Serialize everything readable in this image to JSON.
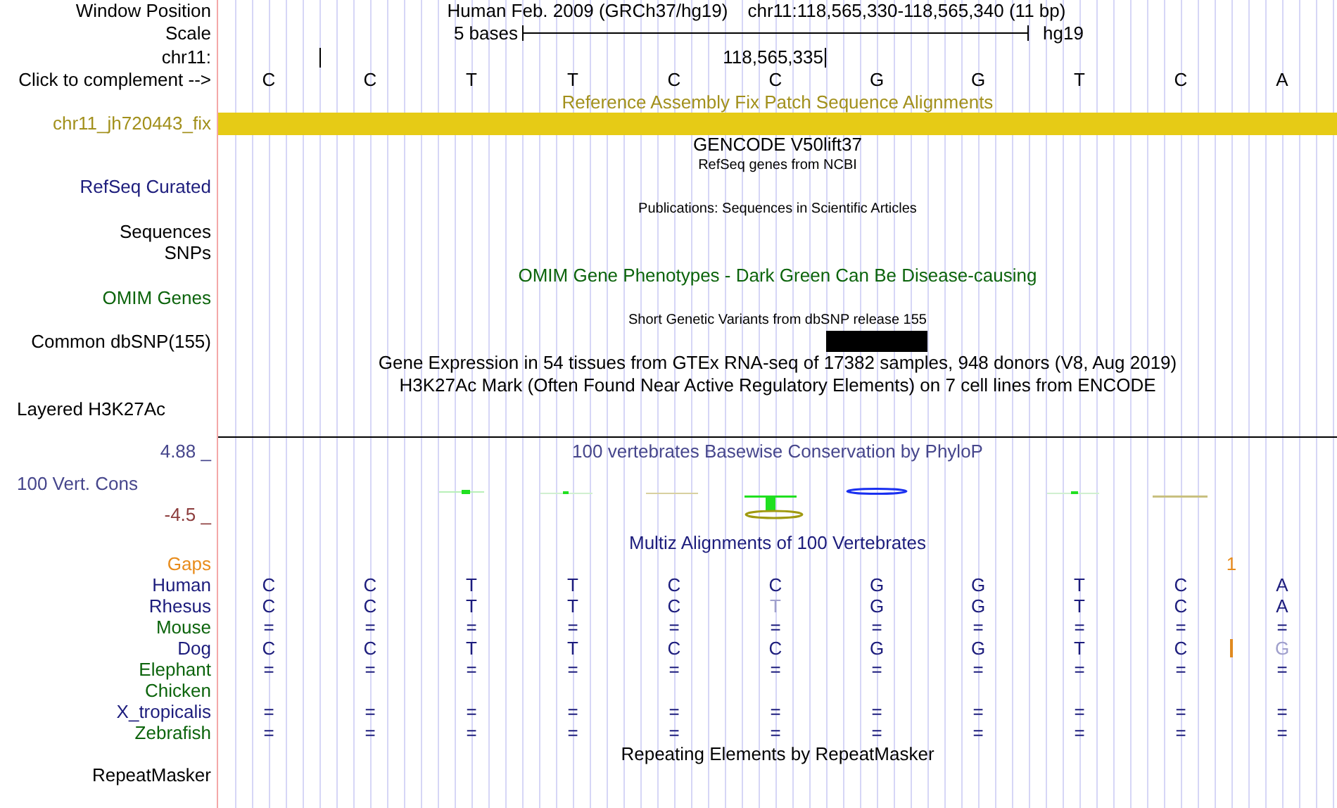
{
  "header": {
    "position_label": "Window Position",
    "assembly": "Human Feb. 2009 (GRCh37/hg19)",
    "position": "chr11:118,565,330-118,565,340 (11 bp)",
    "scale_label": "Scale",
    "scale_text": "5 bases",
    "scale_db": "hg19",
    "chrom_label": "chr11:",
    "coordinate": "118,565,335",
    "complement_link": "Click to complement -->",
    "bases": [
      {
        "base": "C",
        "common_snp": false,
        "gap_after": false
      },
      {
        "base": "C",
        "common_snp": false,
        "gap_after": false
      },
      {
        "base": "T",
        "common_snp": false,
        "gap_after": false
      },
      {
        "base": "T",
        "common_snp": false,
        "gap_after": false
      },
      {
        "base": "C",
        "common_snp": false,
        "gap_after": false
      },
      {
        "base": "C",
        "common_snp": false,
        "gap_after": false
      },
      {
        "base": "G",
        "common_snp": true,
        "gap_after": false
      },
      {
        "base": "G",
        "common_snp": false,
        "gap_after": false
      },
      {
        "base": "T",
        "common_snp": false,
        "gap_after": false
      },
      {
        "base": "C",
        "common_snp": false,
        "gap_after": true
      },
      {
        "base": "A",
        "common_snp": false,
        "gap_after": false
      }
    ]
  },
  "fix_patch": {
    "title": "Reference Assembly Fix Patch Sequence Alignments",
    "label": "chr11_jh720443_fix"
  },
  "gencode": {
    "title": "GENCODE V50lift37"
  },
  "refseq": {
    "title": "RefSeq genes from NCBI",
    "label": "RefSeq Curated"
  },
  "publications": {
    "title": "Publications: Sequences in Scientific Articles",
    "labels": [
      "Sequences",
      "SNPs"
    ]
  },
  "omim": {
    "title": "OMIM Gene Phenotypes - Dark Green Can Be Disease-causing",
    "label": "OMIM Genes"
  },
  "dbsnp": {
    "title": "Short Genetic Variants from dbSNP release 155",
    "label": "Common dbSNP(155)"
  },
  "expression": {
    "title": "Gene Expression in 54 tissues from GTEx RNA-seq of 17382 samples, 948 donors (V8, Aug 2019)"
  },
  "h3k27ac": {
    "title": "H3K27Ac Mark (Often Found Near Active Regulatory Elements) on 7 cell lines from ENCODE",
    "label": "Layered H3K27Ac"
  },
  "conservation": {
    "title": "100 vertebrates Basewise Conservation by PhyloP",
    "label": "100 Vert. Cons",
    "max": "4.88 _",
    "min": "-4.5 _"
  },
  "multiz": {
    "title": "Multiz Alignments of 100 Vertebrates",
    "gaps": {
      "label": "Gaps",
      "count": "1"
    },
    "species": [
      {
        "name": "Human",
        "color": "#1c1c7c",
        "cells": [
          {
            "base": "C",
            "faded": false
          },
          {
            "base": "C",
            "faded": false
          },
          {
            "base": "T",
            "faded": false
          },
          {
            "base": "T",
            "faded": false
          },
          {
            "base": "C",
            "faded": false
          },
          {
            "base": "C",
            "faded": false
          },
          {
            "base": "G",
            "faded": false
          },
          {
            "base": "G",
            "faded": false
          },
          {
            "base": "T",
            "faded": false
          },
          {
            "base": "C",
            "faded": false
          },
          {
            "base": "A",
            "faded": false
          }
        ]
      },
      {
        "name": "Rhesus",
        "color": "#1c1c7c",
        "cells": [
          {
            "base": "C",
            "faded": false
          },
          {
            "base": "C",
            "faded": false
          },
          {
            "base": "T",
            "faded": false
          },
          {
            "base": "T",
            "faded": false
          },
          {
            "base": "C",
            "faded": false
          },
          {
            "base": "T",
            "faded": true
          },
          {
            "base": "G",
            "faded": false
          },
          {
            "base": "G",
            "faded": false
          },
          {
            "base": "T",
            "faded": false
          },
          {
            "base": "C",
            "faded": false
          },
          {
            "base": "A",
            "faded": false
          }
        ]
      },
      {
        "name": "Mouse",
        "color": "#0c640c",
        "cells": [
          {
            "base": "=",
            "faded": false
          },
          {
            "base": "=",
            "faded": false
          },
          {
            "base": "=",
            "faded": false
          },
          {
            "base": "=",
            "faded": false
          },
          {
            "base": "=",
            "faded": false
          },
          {
            "base": "=",
            "faded": false
          },
          {
            "base": "=",
            "faded": false
          },
          {
            "base": "=",
            "faded": false
          },
          {
            "base": "=",
            "faded": false
          },
          {
            "base": "=",
            "faded": false
          },
          {
            "base": "=",
            "faded": false
          }
        ]
      },
      {
        "name": "Dog",
        "color": "#1c1c7c",
        "cells": [
          {
            "base": "C",
            "faded": false,
            "insert_after": false
          },
          {
            "base": "C",
            "faded": false,
            "insert_after": false
          },
          {
            "base": "T",
            "faded": false,
            "insert_after": false
          },
          {
            "base": "T",
            "faded": false,
            "insert_after": false
          },
          {
            "base": "C",
            "faded": false,
            "insert_after": false
          },
          {
            "base": "C",
            "faded": false,
            "insert_after": false
          },
          {
            "base": "G",
            "faded": false,
            "insert_after": false
          },
          {
            "base": "G",
            "faded": false,
            "insert_after": false
          },
          {
            "base": "T",
            "faded": false,
            "insert_after": false
          },
          {
            "base": "C",
            "faded": false,
            "insert_after": true
          },
          {
            "base": "G",
            "faded": true,
            "insert_after": false
          }
        ]
      },
      {
        "name": "Elephant",
        "color": "#0c640c",
        "cells": [
          {
            "base": "=",
            "faded": false
          },
          {
            "base": "=",
            "faded": false
          },
          {
            "base": "=",
            "faded": false
          },
          {
            "base": "=",
            "faded": false
          },
          {
            "base": "=",
            "faded": false
          },
          {
            "base": "=",
            "faded": false
          },
          {
            "base": "=",
            "faded": false
          },
          {
            "base": "=",
            "faded": false
          },
          {
            "base": "=",
            "faded": false
          },
          {
            "base": "=",
            "faded": false
          },
          {
            "base": "=",
            "faded": false
          }
        ]
      },
      {
        "name": "Chicken",
        "color": "#0c640c"
      },
      {
        "name": "X_tropicalis",
        "color": "#1c1c7c",
        "cells": [
          {
            "base": "=",
            "faded": false
          },
          {
            "base": "=",
            "faded": false
          },
          {
            "base": "=",
            "faded": false
          },
          {
            "base": "=",
            "faded": false
          },
          {
            "base": "=",
            "faded": false
          },
          {
            "base": "=",
            "faded": false
          },
          {
            "base": "=",
            "faded": false
          },
          {
            "base": "=",
            "faded": false
          },
          {
            "base": "=",
            "faded": false
          },
          {
            "base": "=",
            "faded": false
          },
          {
            "base": "=",
            "faded": false
          }
        ]
      },
      {
        "name": "Zebrafish",
        "color": "#0c640c",
        "cells": [
          {
            "base": "=",
            "faded": false
          },
          {
            "base": "=",
            "faded": false
          },
          {
            "base": "=",
            "faded": false
          },
          {
            "base": "=",
            "faded": false
          },
          {
            "base": "=",
            "faded": false
          },
          {
            "base": "=",
            "faded": false
          },
          {
            "base": "=",
            "faded": false
          },
          {
            "base": "=",
            "faded": false
          },
          {
            "base": "=",
            "faded": false
          },
          {
            "base": "=",
            "faded": false
          },
          {
            "base": "=",
            "faded": false
          }
        ]
      }
    ]
  },
  "repeatmasker": {
    "title": "Repeating Elements by RepeatMasker",
    "label": "RepeatMasker"
  }
}
